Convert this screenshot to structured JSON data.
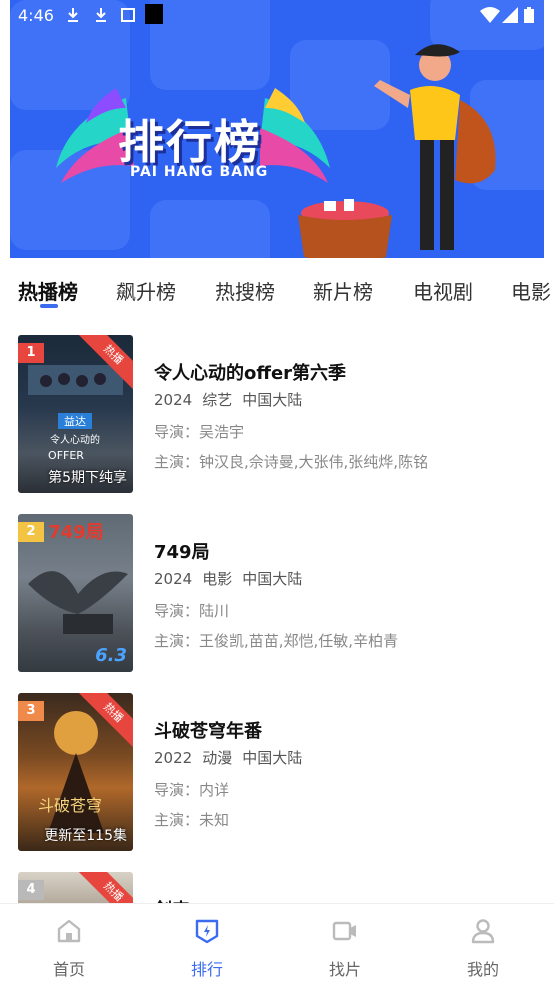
{
  "status_bar": {
    "time": "4:46"
  },
  "banner": {
    "title": "排行榜",
    "subtitle": "PAI HANG BANG"
  },
  "tabs": [
    {
      "label": "热播榜",
      "active": true
    },
    {
      "label": "飙升榜",
      "active": false
    },
    {
      "label": "热搜榜",
      "active": false
    },
    {
      "label": "新片榜",
      "active": false
    },
    {
      "label": "电视剧",
      "active": false
    },
    {
      "label": "电影",
      "active": false
    }
  ],
  "list": [
    {
      "rank": "1",
      "badge": "热播",
      "title": "令人心动的offer第六季",
      "year": "2024",
      "genre": "综艺",
      "region": "中国大陆",
      "director": "导演：吴浩宇",
      "cast": "主演：钟汉良,佘诗曼,大张伟,张纯烨,陈铭",
      "poster_caption": "第5期下纯享"
    },
    {
      "rank": "2",
      "badge": "",
      "title": "749局",
      "year": "2024",
      "genre": "电影",
      "region": "中国大陆",
      "director": "导演：陆川",
      "cast": "主演：王俊凯,苗苗,郑恺,任敏,辛柏青",
      "poster_caption": "",
      "poster_score": "6.3"
    },
    {
      "rank": "3",
      "badge": "热播",
      "title": "斗破苍穹年番",
      "year": "2022",
      "genre": "动漫",
      "region": "中国大陆",
      "director": "导演：内详",
      "cast": "主演：未知",
      "poster_caption": "更新至115集"
    },
    {
      "rank": "4",
      "badge": "热播",
      "title": "剑来"
    }
  ],
  "bottom_nav": [
    {
      "label": "首页",
      "icon": "home-icon",
      "active": false
    },
    {
      "label": "排行",
      "icon": "ranking-icon",
      "active": true
    },
    {
      "label": "找片",
      "icon": "video-camera-icon",
      "active": false
    },
    {
      "label": "我的",
      "icon": "user-icon",
      "active": false
    }
  ],
  "colors": {
    "accent": "#3b6cf0",
    "banner_bg": "#2f63f2",
    "rank1": "#e6463d",
    "rank2": "#f3c443",
    "rank3": "#f08a4b",
    "rank4": "#b9b9b9"
  }
}
